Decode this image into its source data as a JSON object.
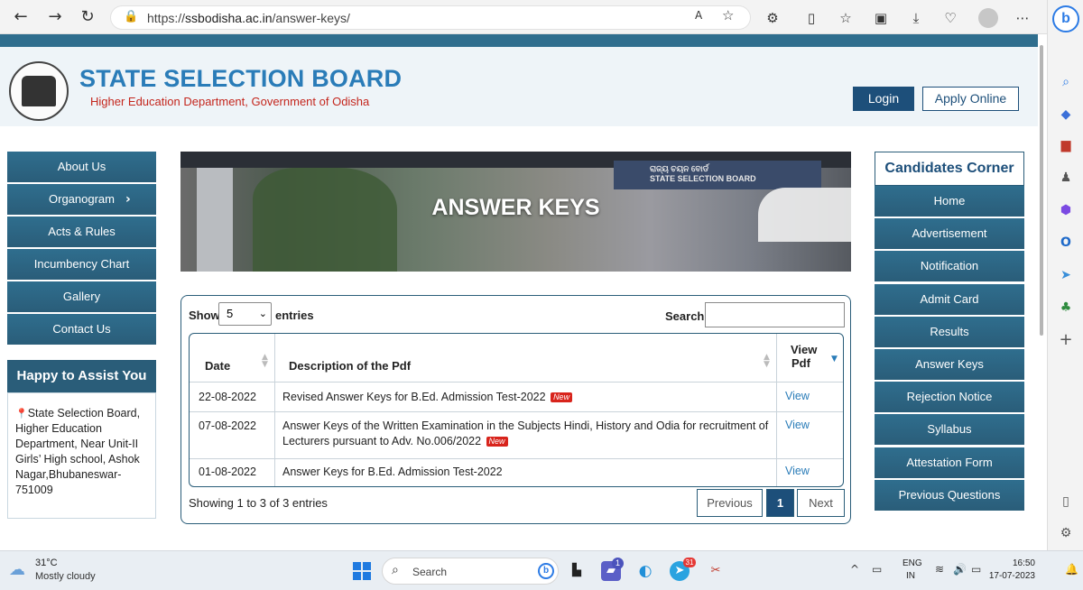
{
  "browser": {
    "url_prefix": "https://",
    "url_host": "ssbodisha.ac.in",
    "url_path": "/answer-keys/"
  },
  "header": {
    "title": "STATE SELECTION BOARD",
    "subtitle": "Higher Education Department, Government of Odisha",
    "login_label": "Login",
    "apply_label": "Apply Online"
  },
  "left_nav": {
    "items": [
      {
        "label": "About Us"
      },
      {
        "label": "Organogram"
      },
      {
        "label": "Acts & Rules"
      },
      {
        "label": "Incumbency Chart"
      },
      {
        "label": "Gallery"
      },
      {
        "label": "Contact Us"
      }
    ]
  },
  "assist": {
    "title": "Happy to Assist You",
    "address": "State Selection Board, Higher Education Department, Near Unit-II Girls’ High school, Ashok Nagar,Bhubaneswar-751009"
  },
  "banner": {
    "title": "ANSWER KEYS",
    "sign_line1": "ରାଜ୍ୟ ଚୟନ ବୋର୍ଡ",
    "sign_line2": "STATE SELECTION BOARD"
  },
  "table": {
    "show_label": "Show",
    "page_size": "5",
    "entries_label": "entries",
    "search_label": "Search:",
    "search_value": "",
    "columns": {
      "date": "Date",
      "desc": "Description of the Pdf",
      "view_line1": "View",
      "view_line2": "Pdf"
    },
    "rows": [
      {
        "date": "22-08-2022",
        "desc": "Revised Answer Keys for B.Ed. Admission Test-2022",
        "new": "New",
        "view": "View"
      },
      {
        "date": "07-08-2022",
        "desc_line1": "Answer Keys of the Written Examination in the Subjects Hindi, History and Odia for recruitment of",
        "desc_line2": "Lecturers pursuant to Adv. No.006/2022",
        "new": "New",
        "view": "View"
      },
      {
        "date": "01-08-2022",
        "desc": "Answer Keys for B.Ed. Admission Test-2022",
        "view": "View"
      }
    ],
    "info": "Showing 1 to 3 of 3 entries",
    "pagination": {
      "previous": "Previous",
      "current": "1",
      "next": "Next"
    }
  },
  "candidates_corner": {
    "title": "Candidates Corner",
    "items": [
      {
        "label": "Home"
      },
      {
        "label": "Advertisement"
      },
      {
        "label": "Notification"
      },
      {
        "label": "Admit Card"
      },
      {
        "label": "Results"
      },
      {
        "label": "Answer Keys"
      },
      {
        "label": "Rejection Notice"
      },
      {
        "label": "Syllabus"
      },
      {
        "label": "Attestation Form"
      },
      {
        "label": "Previous Questions"
      }
    ]
  },
  "taskbar": {
    "temperature": "31°C",
    "weather": "Mostly cloudy",
    "search_label": "Search",
    "lang_top": "ENG",
    "lang_bottom": "IN",
    "time": "16:50",
    "date": "17-07-2023",
    "teams_badge": "1",
    "telegram_badge": "31"
  },
  "colors": {
    "brand_blue": "#2a7cb8",
    "nav_blue": "#2a5d79",
    "dark_blue": "#1d4f7a",
    "accent_red": "#c4261d"
  }
}
